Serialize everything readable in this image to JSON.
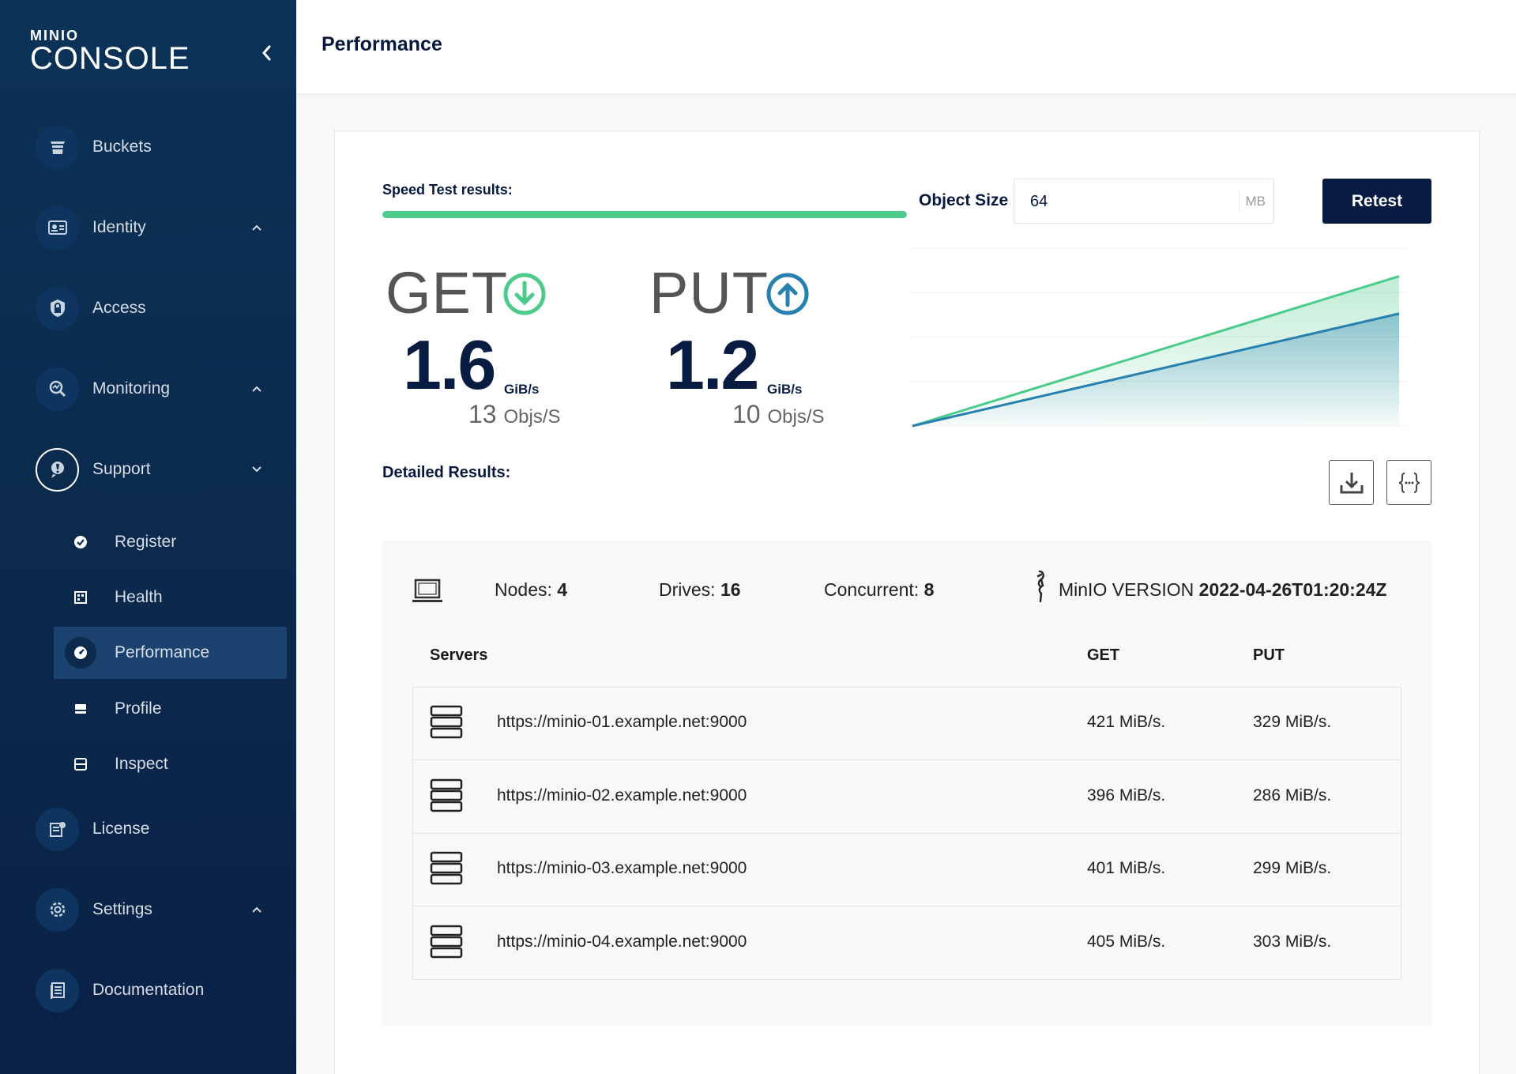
{
  "brand": {
    "small": "MINIO",
    "big": "CONSOLE"
  },
  "sidebar": {
    "items": [
      {
        "label": "Buckets",
        "icon": "bucket-icon"
      },
      {
        "label": "Identity",
        "icon": "id-card-icon"
      },
      {
        "label": "Access",
        "icon": "lock-icon"
      },
      {
        "label": "Monitoring",
        "icon": "monitoring-icon"
      },
      {
        "label": "Support",
        "icon": "support-icon"
      },
      {
        "label": "License",
        "icon": "license-icon"
      },
      {
        "label": "Settings",
        "icon": "gear-icon"
      },
      {
        "label": "Documentation",
        "icon": "document-icon"
      }
    ],
    "support_sub": [
      {
        "label": "Register",
        "icon": "check-badge-icon"
      },
      {
        "label": "Health",
        "icon": "health-icon"
      },
      {
        "label": "Performance",
        "icon": "speedometer-icon"
      },
      {
        "label": "Profile",
        "icon": "profile-icon"
      },
      {
        "label": "Inspect",
        "icon": "inspect-icon"
      }
    ]
  },
  "header": {
    "title": "Performance"
  },
  "speedtest": {
    "label": "Speed Test results:",
    "progress": 1.0,
    "object_size_label": "Object Size",
    "object_size_value": "64",
    "object_size_unit": "MB",
    "retest_label": "Retest",
    "get": {
      "label": "GET",
      "value": "1.6",
      "unit": "GiB/s",
      "objs": "13",
      "objs_unit": "Objs/S"
    },
    "put": {
      "label": "PUT",
      "value": "1.2",
      "unit": "GiB/s",
      "objs": "10",
      "objs_unit": "Objs/S"
    },
    "colors": {
      "get": "#4ccb8d",
      "put": "#2781b0"
    }
  },
  "chart_data": {
    "type": "area",
    "x": [
      0,
      1
    ],
    "series": [
      {
        "values": [
          0,
          1.6
        ]
      },
      {
        "values": [
          0,
          1.2
        ]
      }
    ],
    "ylim": [
      0,
      1.9
    ]
  },
  "detailed": {
    "label": "Detailed Results:",
    "nodes_label": "Nodes:",
    "nodes": "4",
    "drives_label": "Drives:",
    "drives": "16",
    "concurrent_label": "Concurrent:",
    "concurrent": "8",
    "version_label": "MinIO VERSION",
    "version": "2022-04-26T01:20:24Z",
    "columns": {
      "servers": "Servers",
      "get": "GET",
      "put": "PUT"
    },
    "rows": [
      {
        "server": "https://minio-01.example.net:9000",
        "get": "421 MiB/s.",
        "put": "329 MiB/s."
      },
      {
        "server": "https://minio-02.example.net:9000",
        "get": "396 MiB/s.",
        "put": "286 MiB/s."
      },
      {
        "server": "https://minio-03.example.net:9000",
        "get": "401 MiB/s.",
        "put": "299 MiB/s."
      },
      {
        "server": "https://minio-04.example.net:9000",
        "get": "405 MiB/s.",
        "put": "303 MiB/s."
      }
    ]
  }
}
